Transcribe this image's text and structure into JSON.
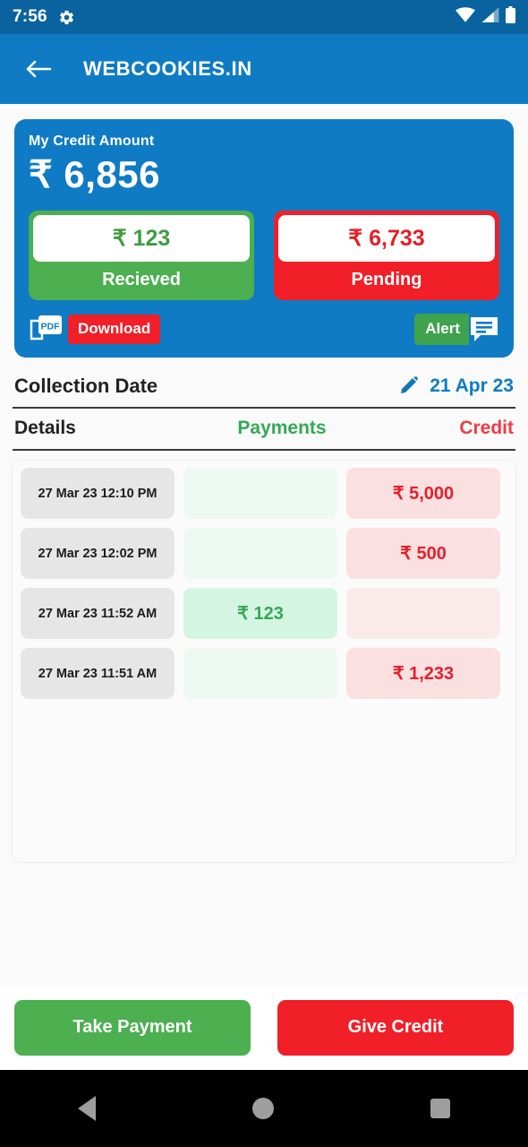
{
  "status_bar": {
    "time": "7:56",
    "icons": [
      "gear-icon",
      "wifi-icon",
      "cellular-signal-icon",
      "battery-icon"
    ]
  },
  "app_bar": {
    "back_icon": "back-arrow-icon",
    "title": "WEBCOOKIES.IN"
  },
  "credit_card": {
    "label": "My Credit Amount",
    "amount": "₹ 6,856",
    "received": {
      "amount": "₹ 123",
      "caption": "Recieved"
    },
    "pending": {
      "amount": "₹ 6,733",
      "caption": "Pending"
    },
    "pdf_icon_label": "PDF",
    "download_label": "Download",
    "alert_label": "Alert",
    "chat_icon": "message-icon"
  },
  "collection": {
    "title": "Collection Date",
    "edit_icon": "pencil-icon",
    "date": "21 Apr 23"
  },
  "table": {
    "headers": {
      "details": "Details",
      "payments": "Payments",
      "credit": "Credit"
    },
    "rows": [
      {
        "date": "27 Mar 23 12:10 PM",
        "payment": "",
        "credit": "₹ 5,000"
      },
      {
        "date": "27 Mar 23 12:02 PM",
        "payment": "",
        "credit": "₹ 500"
      },
      {
        "date": "27 Mar 23 11:52 AM",
        "payment": "₹ 123",
        "credit": ""
      },
      {
        "date": "27 Mar 23 11:51 AM",
        "payment": "",
        "credit": "₹ 1,233"
      }
    ]
  },
  "bottom_actions": {
    "take_payment": "Take Payment",
    "give_credit": "Give Credit"
  },
  "nav_bar": {
    "back": "nav-back-icon",
    "home": "nav-home-icon",
    "recents": "nav-recents-icon"
  },
  "colors": {
    "status_bar": "#0a639f",
    "app_bar": "#0f7bc4",
    "green": "#4caf50",
    "red": "#f01f28",
    "payments_text": "#35a853",
    "credit_text": "#ef3b45",
    "date_link": "#0f7bc4"
  }
}
